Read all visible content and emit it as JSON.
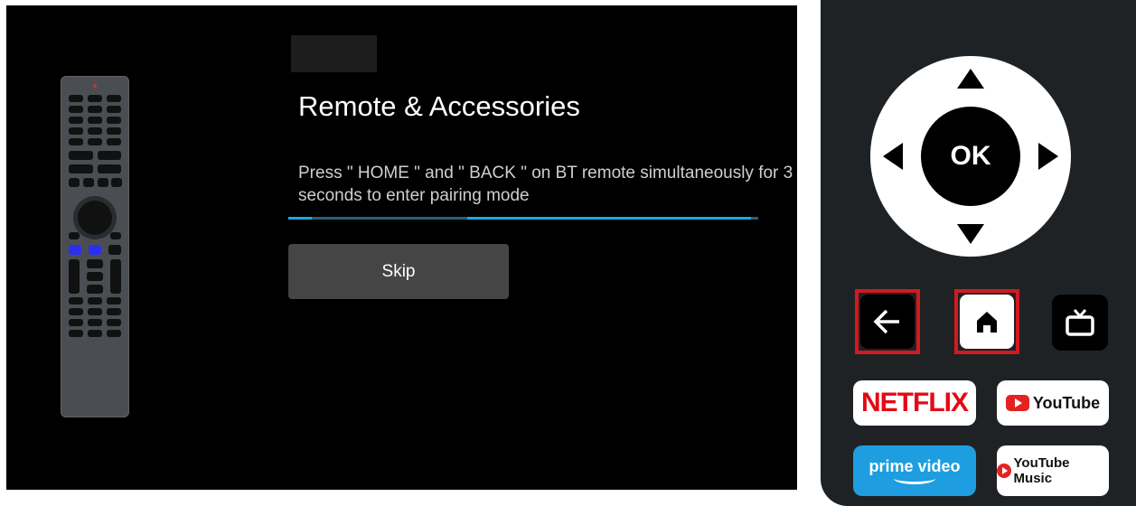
{
  "screen": {
    "title": "Remote & Accessories",
    "instruction": "Press \" HOME \" and \" BACK \" on BT remote simultaneously for 3 seconds to enter pairing mode",
    "skip_label": "Skip",
    "progress_color": "#1ea7e8"
  },
  "remote": {
    "ok_label": "OK",
    "netflix_label": "NETFLIX",
    "youtube_label": "YouTube",
    "prime_label": "prime video",
    "youtube_music_label": "YouTube Music",
    "highlight_color": "#d4191e",
    "icons": [
      "arrow-up-icon",
      "arrow-down-icon",
      "arrow-left-icon",
      "arrow-right-icon",
      "back-arrow-icon",
      "home-icon",
      "tv-icon"
    ]
  }
}
